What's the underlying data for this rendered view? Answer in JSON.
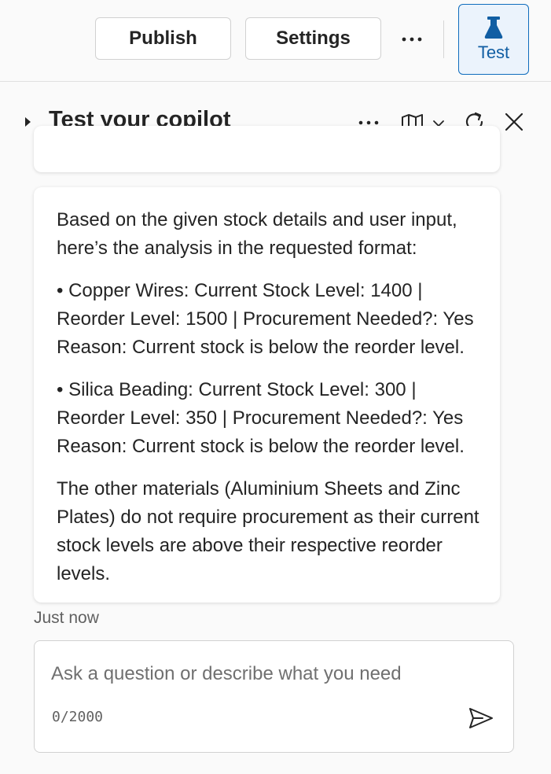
{
  "toolbar": {
    "publish_label": "Publish",
    "settings_label": "Settings",
    "more_icon": "more-horizontal-icon",
    "test_label": "Test",
    "test_icon": "beaker-icon"
  },
  "panel": {
    "title": "Test your copilot",
    "icons": [
      "more-horizontal-icon",
      "map-icon",
      "chevron-down-icon",
      "refresh-icon",
      "close-icon"
    ]
  },
  "chat": {
    "message": {
      "paragraphs": [
        "Based on the given stock details and user input, here’s the analysis in the requested format:",
        "• Copper Wires: Current Stock Level: 1400 | Reorder Level: 1500 | Procurement Needed?: Yes Reason: Current stock is below the reorder level.",
        "• Silica Beading: Current Stock Level: 300 | Reorder Level: 350 | Procurement Needed?: Yes Reason: Current stock is below the reorder level.",
        "The other materials (Aluminium Sheets and Zinc Plates) do not require procurement as their current stock levels are above their respective reorder levels."
      ],
      "timestamp": "Just now"
    },
    "composer": {
      "placeholder": "Ask a question or describe what you need",
      "value": "",
      "char_count": "0/2000",
      "send_icon": "send-icon"
    }
  },
  "colors": {
    "accent": "#0f6cbd",
    "test_button_bg": "#ebf3fc",
    "panel_bg": "#fafafa",
    "text": "#242424"
  }
}
